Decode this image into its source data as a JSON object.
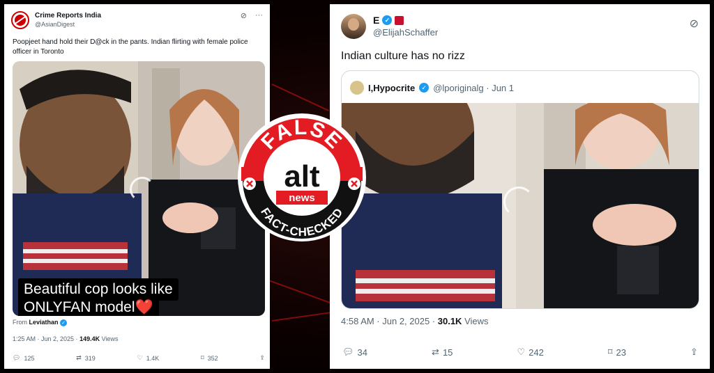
{
  "left_tweet": {
    "author": "Crime Reports India",
    "handle": "@AsianDigest",
    "text": "Poopjeet hand hold their D@ck in the pants. Indian flirting with female police officer in Toronto",
    "caption_line1": "Beautiful cop looks like",
    "caption_line2": "ONLYFAN model❤️",
    "from_label": "From",
    "from_source": "Leviathan",
    "time": "1:25 AM · Jun 2, 2025 · ",
    "views_count": "149.4K",
    "views_label": " Views",
    "replies": "125",
    "reposts": "319",
    "likes": "1.4K",
    "bookmarks": "352"
  },
  "right_tweet": {
    "author": "E",
    "handle": "@ElijahSchaffer",
    "text": "Indian culture has no rizz",
    "quote_author": "I,Hypocrite",
    "quote_handle": "@lporiginalg · Jun 1",
    "time": "4:58 AM · Jun 2, 2025 · ",
    "views_count": "30.1K",
    "views_label": " Views",
    "replies": "34",
    "reposts": "15",
    "likes": "242",
    "bookmarks": "23"
  },
  "badge": {
    "top_text": "FALSE",
    "logo_main": "alt",
    "logo_sub": "news",
    "bottom_text": "FACT-CHECKED"
  },
  "colors": {
    "badge_red": "#e31b23",
    "verified_blue": "#1d9bf0",
    "muted_text": "#536471"
  },
  "icons": [
    "reply-icon",
    "repost-icon",
    "like-icon",
    "bookmark-icon",
    "share-icon",
    "grok-icon",
    "more-icon",
    "verified-icon"
  ]
}
